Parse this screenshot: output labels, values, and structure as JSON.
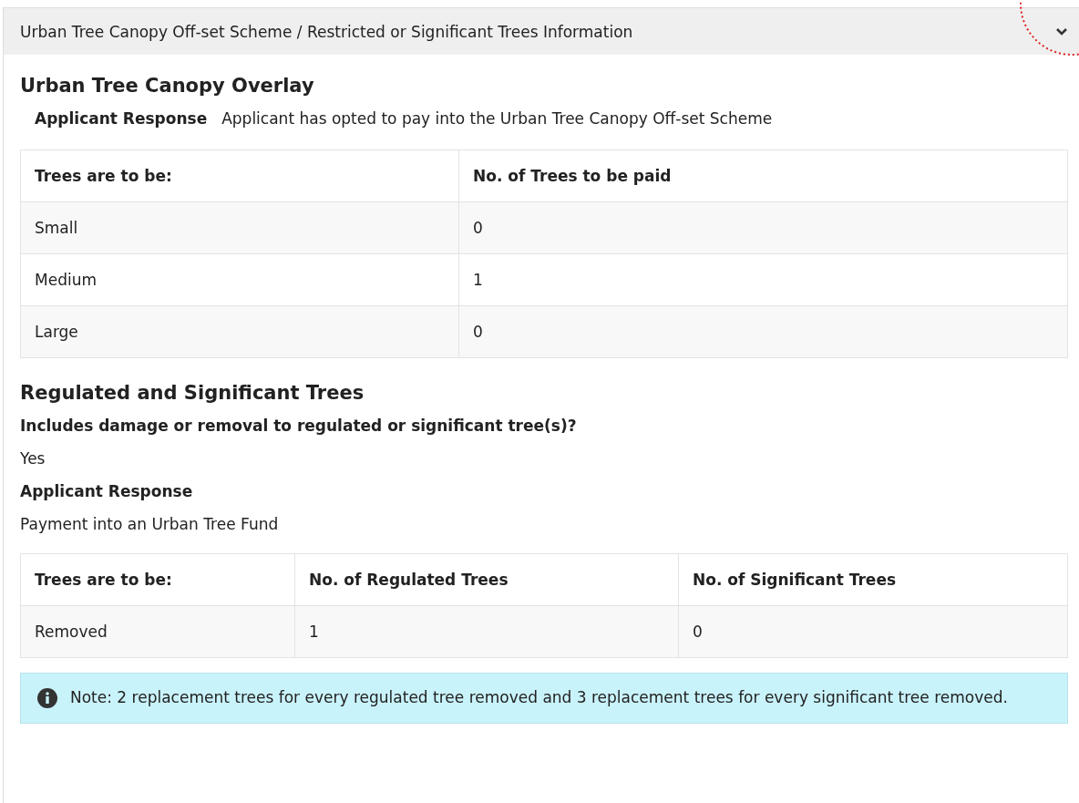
{
  "panel": {
    "title": "Urban Tree Canopy Off-set Scheme / Restricted or Significant Trees Information",
    "expanded": true
  },
  "canopy": {
    "heading": "Urban Tree Canopy Overlay",
    "response_label": "Applicant Response",
    "response_value": "Applicant has opted to pay into the Urban Tree Canopy Off-set Scheme",
    "table": {
      "columns": [
        "Trees are to be:",
        "No. of Trees to be paid"
      ],
      "rows": [
        [
          "Small",
          "0"
        ],
        [
          "Medium",
          "1"
        ],
        [
          "Large",
          "0"
        ]
      ]
    }
  },
  "regulated": {
    "heading": "Regulated and Significant Trees",
    "question": "Includes damage or removal to regulated or significant tree(s)?",
    "answer": "Yes",
    "response_label": "Applicant Response",
    "response_value": "Payment into an Urban Tree Fund",
    "table": {
      "columns": [
        "Trees are to be:",
        "No. of Regulated Trees",
        "No. of Significant Trees"
      ],
      "rows": [
        [
          "Removed",
          "1",
          "0"
        ]
      ]
    }
  },
  "note": "Note: 2 replacement trees for every regulated tree removed and 3 replacement trees for every significant tree removed."
}
